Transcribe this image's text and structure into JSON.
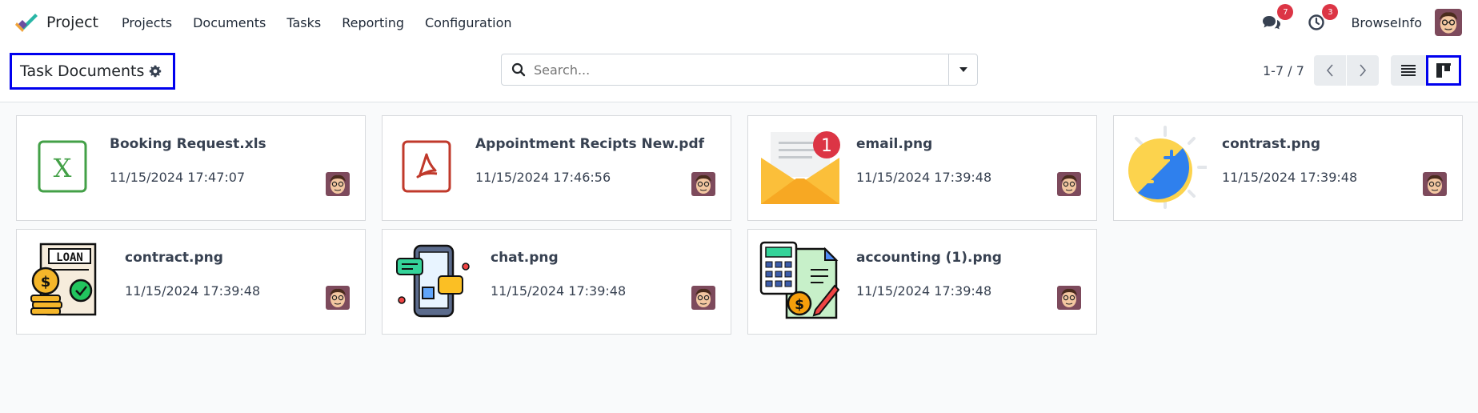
{
  "app": {
    "name": "Project"
  },
  "menu": [
    {
      "label": "Projects"
    },
    {
      "label": "Documents"
    },
    {
      "label": "Tasks"
    },
    {
      "label": "Reporting"
    },
    {
      "label": "Configuration"
    }
  ],
  "systray": {
    "messages_count": "7",
    "activities_count": "3",
    "user_name": "BrowseInfo"
  },
  "breadcrumb": {
    "title": "Task Documents"
  },
  "search": {
    "placeholder": "Search..."
  },
  "pager": {
    "value": "1-7 / 7"
  },
  "documents": [
    {
      "name": "Booking Request.xls",
      "date": "11/15/2024 17:47:07",
      "icon": "excel-file-icon"
    },
    {
      "name": "Appointment Recipts New.pdf",
      "date": "11/15/2024 17:46:56",
      "icon": "pdf-file-icon"
    },
    {
      "name": "email.png",
      "date": "11/15/2024 17:39:48",
      "icon": "email-envelope-icon"
    },
    {
      "name": "contrast.png",
      "date": "11/15/2024 17:39:48",
      "icon": "contrast-icon"
    },
    {
      "name": "contract.png",
      "date": "11/15/2024 17:39:48",
      "icon": "loan-contract-icon"
    },
    {
      "name": "chat.png",
      "date": "11/15/2024 17:39:48",
      "icon": "chat-phone-icon"
    },
    {
      "name": "accounting (1).png",
      "date": "11/15/2024 17:39:48",
      "icon": "accounting-icon"
    }
  ],
  "colors": {
    "accent_blue": "#0000ee",
    "badge_red": "#dc3545"
  }
}
